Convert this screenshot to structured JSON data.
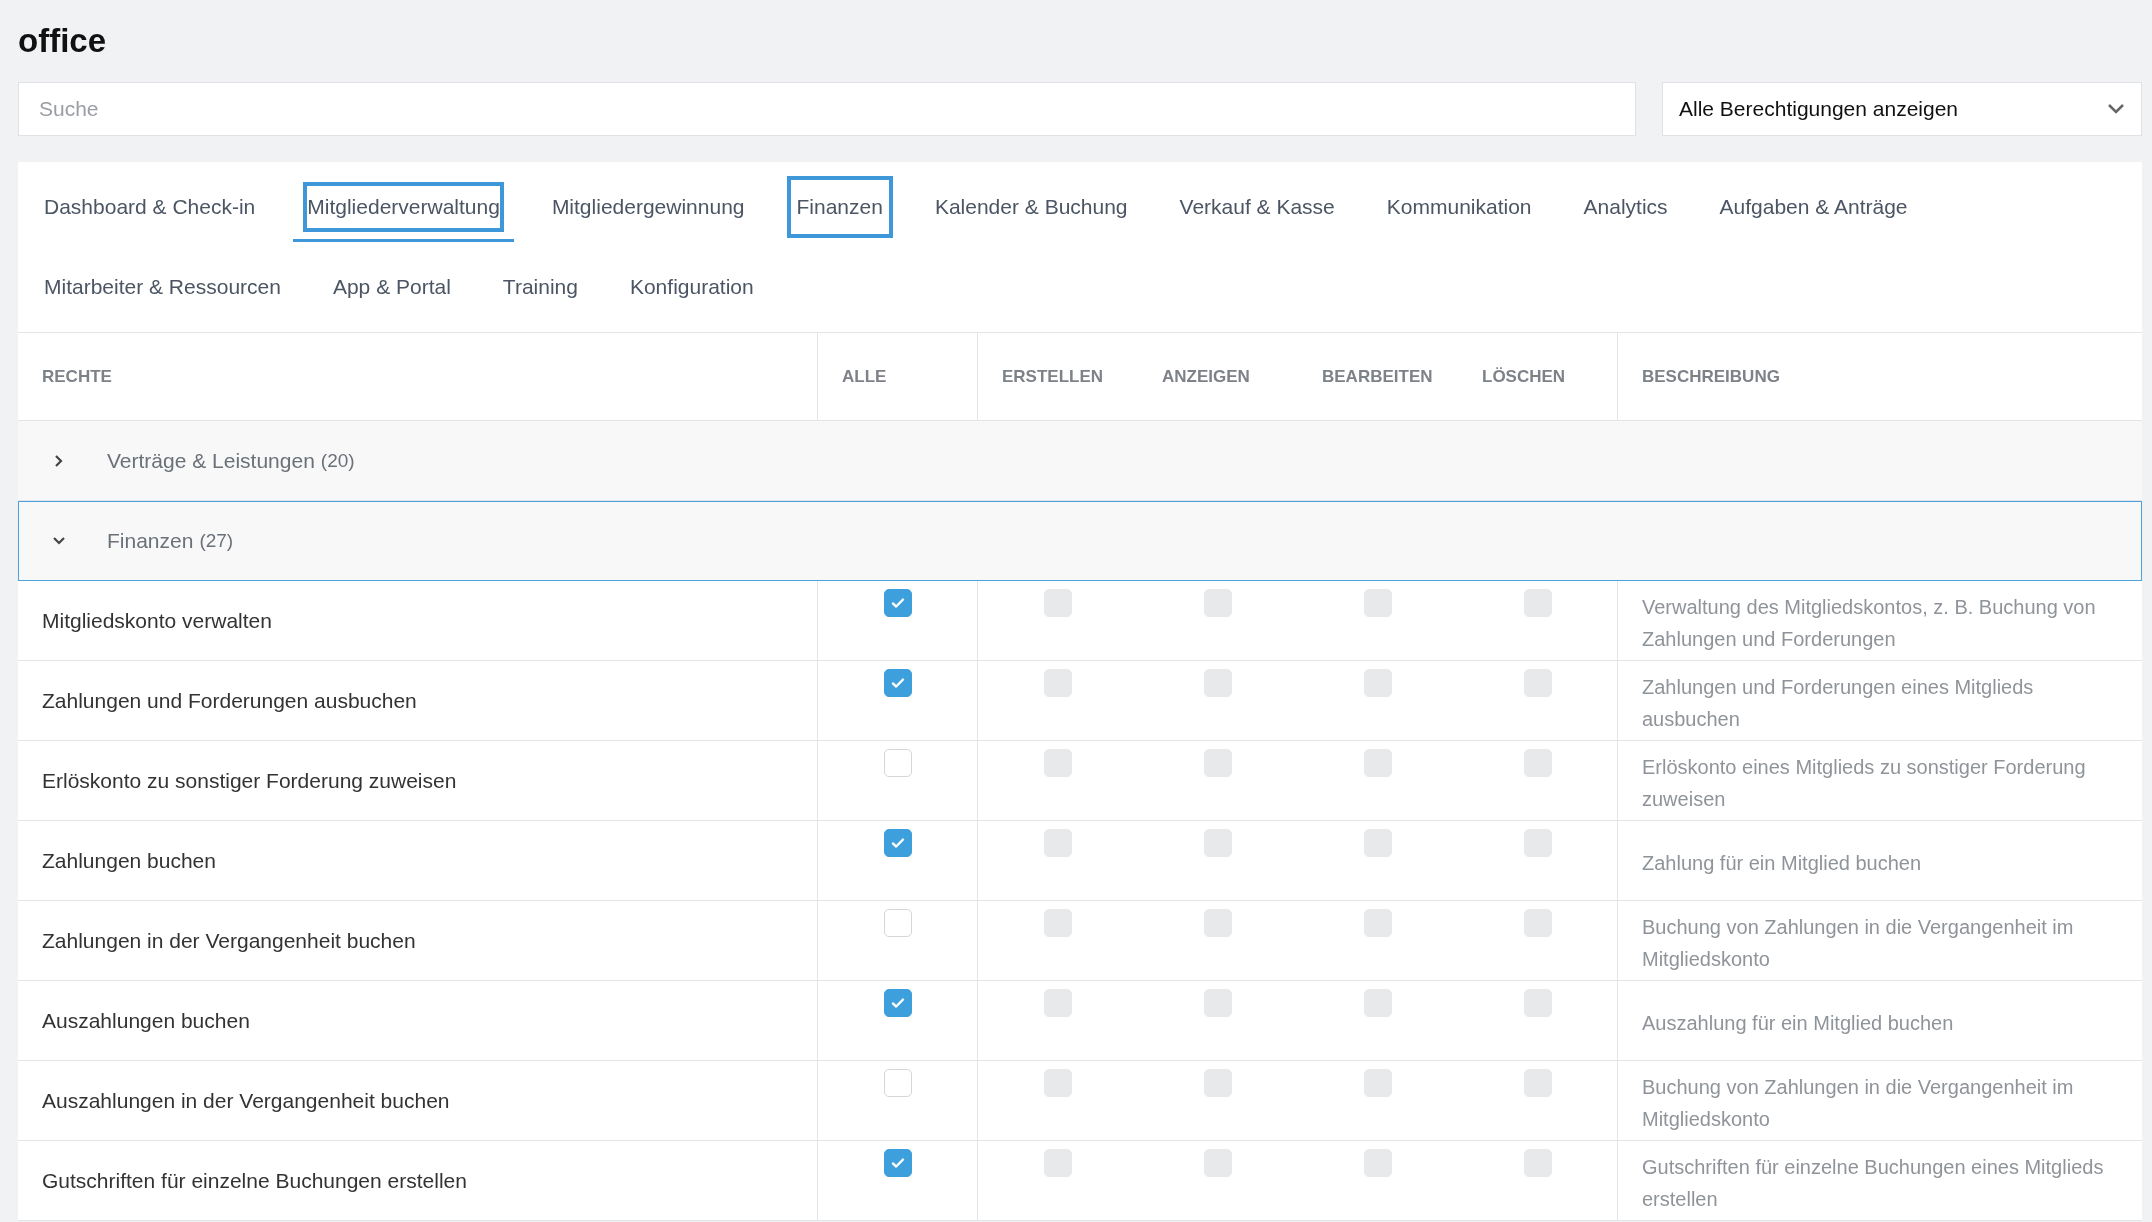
{
  "page": {
    "title": "office"
  },
  "search": {
    "placeholder": "Suche"
  },
  "filter": {
    "value": "Alle Berechtigungen anzeigen"
  },
  "tabs": [
    {
      "label": "Dashboard & Check-in",
      "selected": false,
      "focused": false
    },
    {
      "label": "Mitgliederverwaltung",
      "selected": true,
      "focused": true
    },
    {
      "label": "Mitgliedergewinnung",
      "selected": false,
      "focused": false
    },
    {
      "label": "Finanzen",
      "selected": false,
      "focused": true
    },
    {
      "label": "Kalender & Buchung",
      "selected": false,
      "focused": false
    },
    {
      "label": "Verkauf & Kasse",
      "selected": false,
      "focused": false
    },
    {
      "label": "Kommunikation",
      "selected": false,
      "focused": false
    },
    {
      "label": "Analytics",
      "selected": false,
      "focused": false
    },
    {
      "label": "Aufgaben & Anträge",
      "selected": false,
      "focused": false
    },
    {
      "label": "Mitarbeiter & Ressourcen",
      "selected": false,
      "focused": false
    },
    {
      "label": "App & Portal",
      "selected": false,
      "focused": false
    },
    {
      "label": "Training",
      "selected": false,
      "focused": false
    },
    {
      "label": "Konfiguration",
      "selected": false,
      "focused": false
    }
  ],
  "table": {
    "columns": [
      "RECHTE",
      "ALLE",
      "ERSTELLEN",
      "ANZEIGEN",
      "BEARBEITEN",
      "LÖSCHEN",
      "BESCHREIBUNG"
    ],
    "groups": [
      {
        "name": "Verträge & Leistungen",
        "count": "(20)",
        "expanded": false
      },
      {
        "name": "Finanzen",
        "count": "(27)",
        "expanded": true,
        "rows": [
          {
            "name": "Mitgliedskonto verwalten",
            "all": true,
            "actions": [
              {
                "checked": false,
                "disabled": true
              },
              {
                "checked": false,
                "disabled": true
              },
              {
                "checked": false,
                "disabled": true
              },
              {
                "checked": false,
                "disabled": true
              }
            ],
            "description": "Verwaltung des Mitgliedskontos, z. B. Buchung von Zahlungen und Forderungen"
          },
          {
            "name": "Zahlungen und Forderungen ausbuchen",
            "all": true,
            "actions": [
              {
                "checked": false,
                "disabled": true
              },
              {
                "checked": false,
                "disabled": true
              },
              {
                "checked": false,
                "disabled": true
              },
              {
                "checked": false,
                "disabled": true
              }
            ],
            "description": "Zahlungen und Forderungen eines Mitglieds ausbuchen"
          },
          {
            "name": "Erlöskonto zu sonstiger Forderung zuweisen",
            "all": false,
            "actions": [
              {
                "checked": false,
                "disabled": true
              },
              {
                "checked": false,
                "disabled": true
              },
              {
                "checked": false,
                "disabled": true
              },
              {
                "checked": false,
                "disabled": true
              }
            ],
            "description": "Erlöskonto eines Mitglieds zu sonstiger Forderung zuweisen"
          },
          {
            "name": "Zahlungen buchen",
            "all": true,
            "actions": [
              {
                "checked": false,
                "disabled": true
              },
              {
                "checked": false,
                "disabled": true
              },
              {
                "checked": false,
                "disabled": true
              },
              {
                "checked": false,
                "disabled": true
              }
            ],
            "description": "Zahlung für ein Mitglied buchen"
          },
          {
            "name": "Zahlungen in der Vergangenheit buchen",
            "all": false,
            "actions": [
              {
                "checked": false,
                "disabled": true
              },
              {
                "checked": false,
                "disabled": true
              },
              {
                "checked": false,
                "disabled": true
              },
              {
                "checked": false,
                "disabled": true
              }
            ],
            "description": "Buchung von Zahlungen in die Vergangenheit im Mitgliedskonto"
          },
          {
            "name": "Auszahlungen buchen",
            "all": true,
            "actions": [
              {
                "checked": false,
                "disabled": true
              },
              {
                "checked": false,
                "disabled": true
              },
              {
                "checked": false,
                "disabled": true
              },
              {
                "checked": false,
                "disabled": true
              }
            ],
            "description": "Auszahlung für ein Mitglied buchen"
          },
          {
            "name": "Auszahlungen in der Vergangenheit buchen",
            "all": false,
            "actions": [
              {
                "checked": false,
                "disabled": true
              },
              {
                "checked": false,
                "disabled": true
              },
              {
                "checked": false,
                "disabled": true
              },
              {
                "checked": false,
                "disabled": true
              }
            ],
            "description": "Buchung von Zahlungen in die Vergangenheit im Mitgliedskonto"
          },
          {
            "name": "Gutschriften für einzelne Buchungen erstellen",
            "all": true,
            "actions": [
              {
                "checked": false,
                "disabled": true
              },
              {
                "checked": false,
                "disabled": true
              },
              {
                "checked": false,
                "disabled": true
              },
              {
                "checked": false,
                "disabled": true
              }
            ],
            "description": "Gutschriften für einzelne Buchungen eines Mitglieds erstellen"
          }
        ]
      }
    ]
  }
}
